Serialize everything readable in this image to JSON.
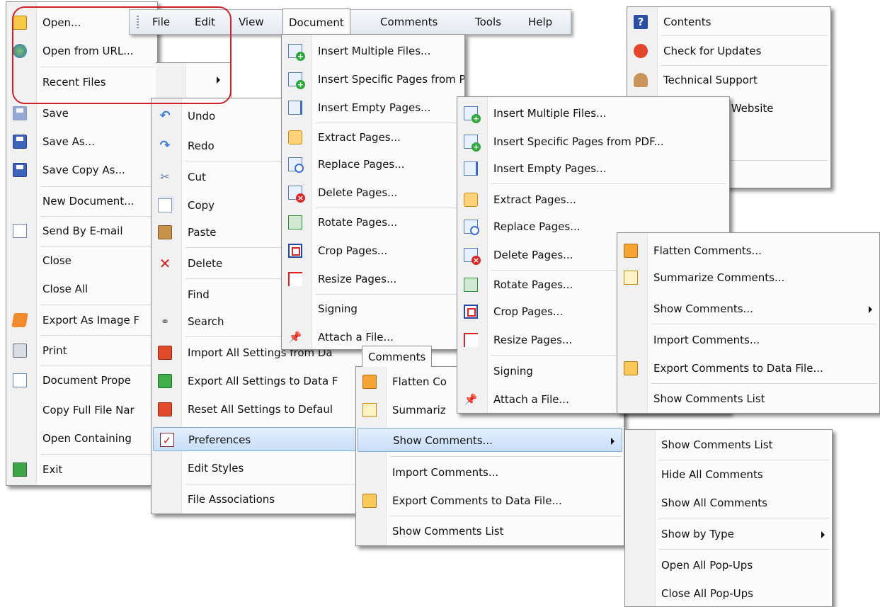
{
  "menubar": {
    "items": [
      "File",
      "Edit",
      "View",
      "Document",
      "Comments",
      "Tools",
      "Help"
    ]
  },
  "file_menu": {
    "items": {
      "open": "Open...",
      "open_url": "Open from URL...",
      "recent": "Recent Files",
      "save": "Save",
      "save_as": "Save As...",
      "save_copy": "Save Copy As...",
      "new_doc": "New Document...",
      "send_email": "Send By E-mail",
      "close": "Close",
      "close_all": "Close All",
      "export_image": "Export As Image F",
      "print": "Print",
      "doc_props": "Document Prope",
      "copy_full": "Copy Full File Nar",
      "open_containing": "Open Containing",
      "exit": "Exit"
    }
  },
  "edit_menu": {
    "items": {
      "undo": "Undo",
      "redo": "Redo",
      "cut": "Cut",
      "copy": "Copy",
      "paste": "Paste",
      "delete": "Delete",
      "find": "Find",
      "search": "Search",
      "import_settings": "Import All Settings from Da",
      "export_settings": "Export All Settings to Data F",
      "reset_settings": "Reset All Settings to Defaul",
      "preferences": "Preferences",
      "edit_styles": "Edit Styles",
      "file_assoc": "File Associations"
    }
  },
  "document_menu": {
    "items": {
      "insert_multiple": "Insert Multiple Files...",
      "insert_specific": "Insert Specific Pages from PDF...",
      "insert_empty": "Insert Empty Pages...",
      "extract": "Extract Pages...",
      "replace": "Replace Pages...",
      "delete": "Delete Pages...",
      "rotate": "Rotate Pages...",
      "crop": "Crop Pages...",
      "resize": "Resize Pages...",
      "signing": "Signing",
      "attach": "Attach a File..."
    }
  },
  "document_menu_2": {
    "items": {
      "insert_multiple": "Insert Multiple Files...",
      "insert_specific": "Insert Specific Pages from PDF...",
      "insert_empty": "Insert Empty Pages...",
      "extract": "Extract Pages...",
      "replace": "Replace Pages...",
      "delete": "Delete Pages...",
      "rotate": "Rotate Pages...",
      "crop": "Crop Pages...",
      "resize": "Resize Pages...",
      "signing": "Signing",
      "attach": "Attach a File..."
    }
  },
  "help_menu": {
    "items": {
      "contents": "Contents",
      "updates": "Check for Updates",
      "support": "Technical Support",
      "website": "'s Website"
    }
  },
  "comments_tab": {
    "label": "Comments"
  },
  "comments_menu": {
    "items": {
      "flatten": "Flatten Co",
      "summarize": "Summariz",
      "show": "Show Comments...",
      "import": "Import Comments...",
      "export": "Export Comments to Data File...",
      "show_list": "Show Comments List"
    }
  },
  "comments_menu_2": {
    "items": {
      "flatten": "Flatten Comments...",
      "summarize": "Summarize Comments...",
      "show": "Show Comments...",
      "import": "Import Comments...",
      "export": "Export Comments to Data File...",
      "show_list": "Show Comments List"
    }
  },
  "show_comments_menu": {
    "items": {
      "show_list": "Show Comments List",
      "hide_all": "Hide All Comments",
      "show_all": "Show All Comments",
      "by_type": "Show by Type",
      "open_popups": "Open All Pop-Ups",
      "close_popups": "Close All Pop-Ups"
    }
  }
}
